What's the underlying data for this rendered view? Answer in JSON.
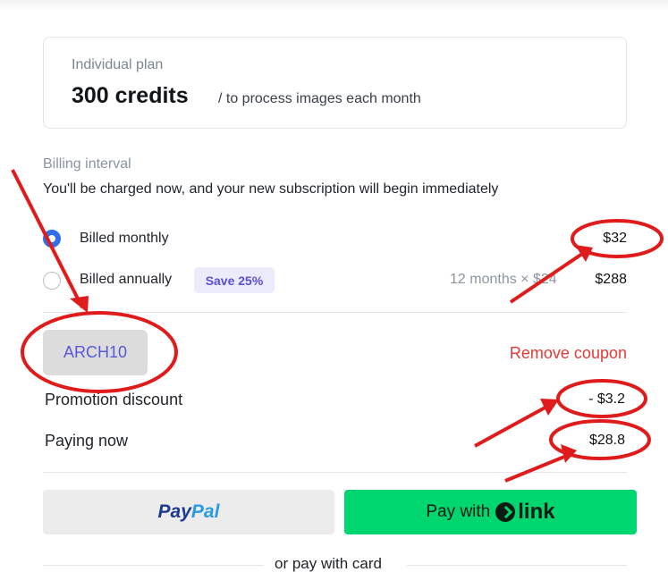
{
  "plan": {
    "name": "Individual plan",
    "credits": "300 credits",
    "subtitle": "/ to process images each month"
  },
  "billing": {
    "title": "Billing interval",
    "description": "You'll be charged now, and your new subscription will begin immediately",
    "options": [
      {
        "label": "Billed monthly",
        "price": "$32",
        "selected": true
      },
      {
        "label": "Billed annually",
        "badge": "Save 25%",
        "calc": "12 months × $24",
        "price": "$288",
        "selected": false
      }
    ]
  },
  "coupon": {
    "code": "ARCH10",
    "remove_label": "Remove coupon"
  },
  "summary": {
    "promotion_label": "Promotion discount",
    "promotion_value": "- $3.2",
    "paying_label": "Paying now",
    "paying_value": "$28.8"
  },
  "payment": {
    "paypal_part1": "Pay",
    "paypal_part2": "Pal",
    "link_prefix": "Pay with",
    "link_word": "link",
    "or_text": "or pay with card"
  },
  "colors": {
    "accent_blue": "#2f6fe8",
    "badge_purple": "#5b4fd6",
    "remove_red": "#e53935",
    "link_green": "#00d66f",
    "annotation_red": "#e01b1b"
  }
}
